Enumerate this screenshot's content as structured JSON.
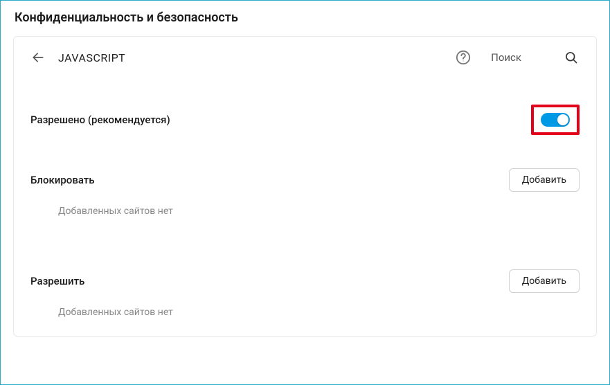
{
  "page": {
    "title": "Конфиденциальность и безопасность"
  },
  "header": {
    "section_title": "JAVASCRIPT",
    "search_label": "Поиск"
  },
  "allowed": {
    "label": "Разрешено (рекомендуется)",
    "toggle_on": true
  },
  "block_section": {
    "title": "Блокировать",
    "add_button": "Добавить",
    "empty_text": "Добавленных сайтов нет"
  },
  "allow_section": {
    "title": "Разрешить",
    "add_button": "Добавить",
    "empty_text": "Добавленных сайтов нет"
  }
}
